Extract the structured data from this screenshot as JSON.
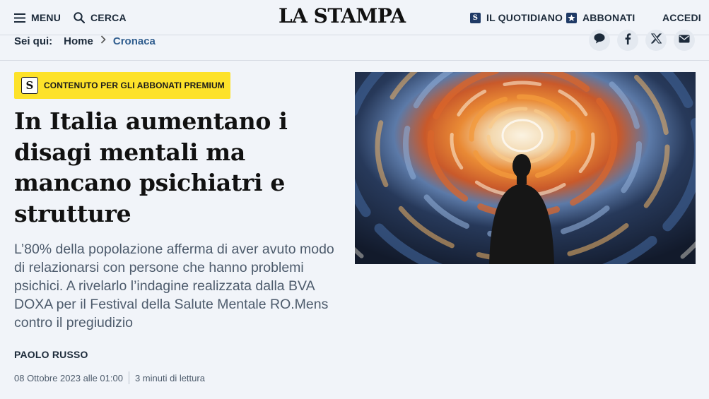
{
  "header": {
    "menu_label": "MENU",
    "search_label": "CERCA",
    "logo_text": "LA STAMPA",
    "quotidiano_label": "IL QUOTIDIANO",
    "quotidiano_icon": "s-square-icon",
    "abbonati_label": "ABBONATI",
    "abbonati_icon": "star-square-icon",
    "login_label": "ACCEDI"
  },
  "breadcrumb": {
    "prefix": "Sei qui:",
    "items": [
      "Home",
      "Cronaca"
    ]
  },
  "share": {
    "icons": [
      "comment-icon",
      "facebook-icon",
      "x-icon",
      "email-icon"
    ]
  },
  "article": {
    "badge_letter": "S",
    "badge_label": "CONTENUTO PER GLI ABBONATI PREMIUM",
    "title": "In Italia aumentano i disagi mentali ma mancano psichiatri e strutture",
    "summary": "L’80% della popolazione afferma di aver avuto modo di relazionarsi con persone che hanno problemi psichici. A rivelarlo l’indagine realizzata dalla BVA DOXA per il Festival della Salute Mentale RO.Mens contro il pregiudizio",
    "author": "PAOLO RUSSO",
    "date": "08 Ottobre 2023 alle 01:00",
    "reading_time": "3 minuti di lettura"
  },
  "colors": {
    "background": "#f1f4f9",
    "accent_blue": "#1f3a66",
    "badge_yellow": "#fde22a",
    "breadcrumb_active": "#2f5d8e"
  }
}
